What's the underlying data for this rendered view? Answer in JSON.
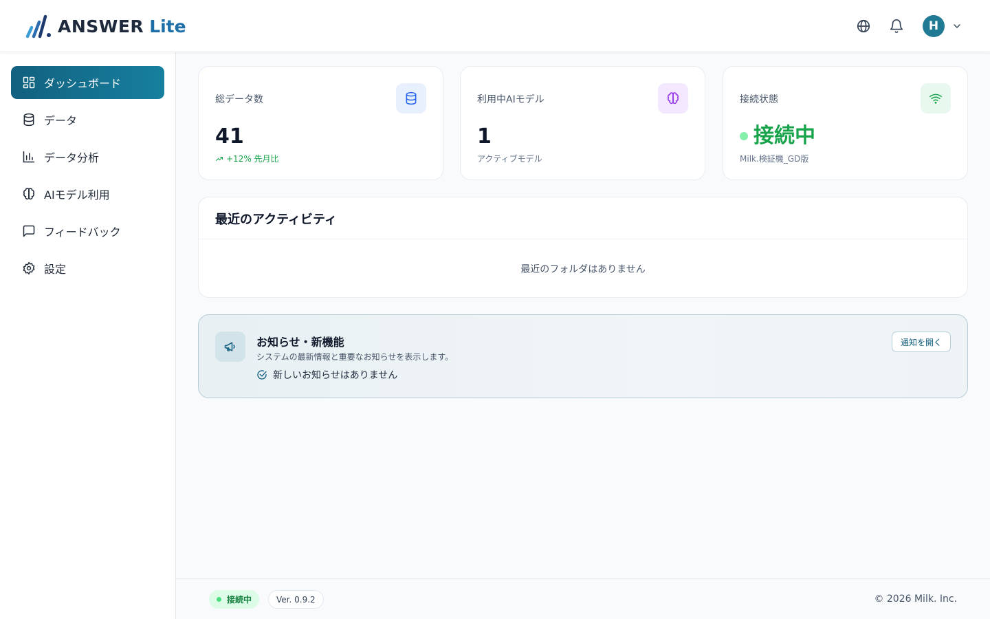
{
  "app": {
    "logo_text": "ANSWER",
    "logo_suffix": "Lite",
    "brand_color": "#12607f"
  },
  "header": {
    "language_icon": "globe-icon",
    "notifications_icon": "bell-icon",
    "user_initial": "H",
    "avatar_color": "#217a93"
  },
  "sidebar": {
    "items": [
      {
        "label": "ダッシュボード",
        "icon": "grid-icon",
        "active": true
      },
      {
        "label": "データ",
        "icon": "database-icon",
        "active": false
      },
      {
        "label": "データ分析",
        "icon": "bar-chart-icon",
        "active": false
      },
      {
        "label": "AIモデル利用",
        "icon": "brain-icon",
        "active": false
      },
      {
        "label": "フィードバック",
        "icon": "message-icon",
        "active": false
      },
      {
        "label": "設定",
        "icon": "gear-icon",
        "active": false
      }
    ]
  },
  "stats": {
    "total": {
      "label": "総データ数",
      "value": "41",
      "sub": "+12% 先月比",
      "icon": "database-icon"
    },
    "model": {
      "label": "利用中AIモデル",
      "value": "1",
      "sub": "アクティブモデル",
      "icon": "brain-icon"
    },
    "connection": {
      "label": "接続状態",
      "value": "接続中",
      "sub": "Milk.検証機_GD版",
      "icon": "wifi-icon"
    }
  },
  "activity": {
    "title": "最近のアクティビティ",
    "empty": "最近のフォルダはありません"
  },
  "notice": {
    "title": "お知らせ・新機能",
    "description": "システムの最新情報と重要なお知らせを表示します。",
    "status": "新しいお知らせはありません",
    "button": "通知を開く",
    "icon": "megaphone-icon"
  },
  "footer": {
    "status": "接続中",
    "version": "Ver. 0.9.2",
    "copyright": "© 2026 Milk. Inc."
  }
}
